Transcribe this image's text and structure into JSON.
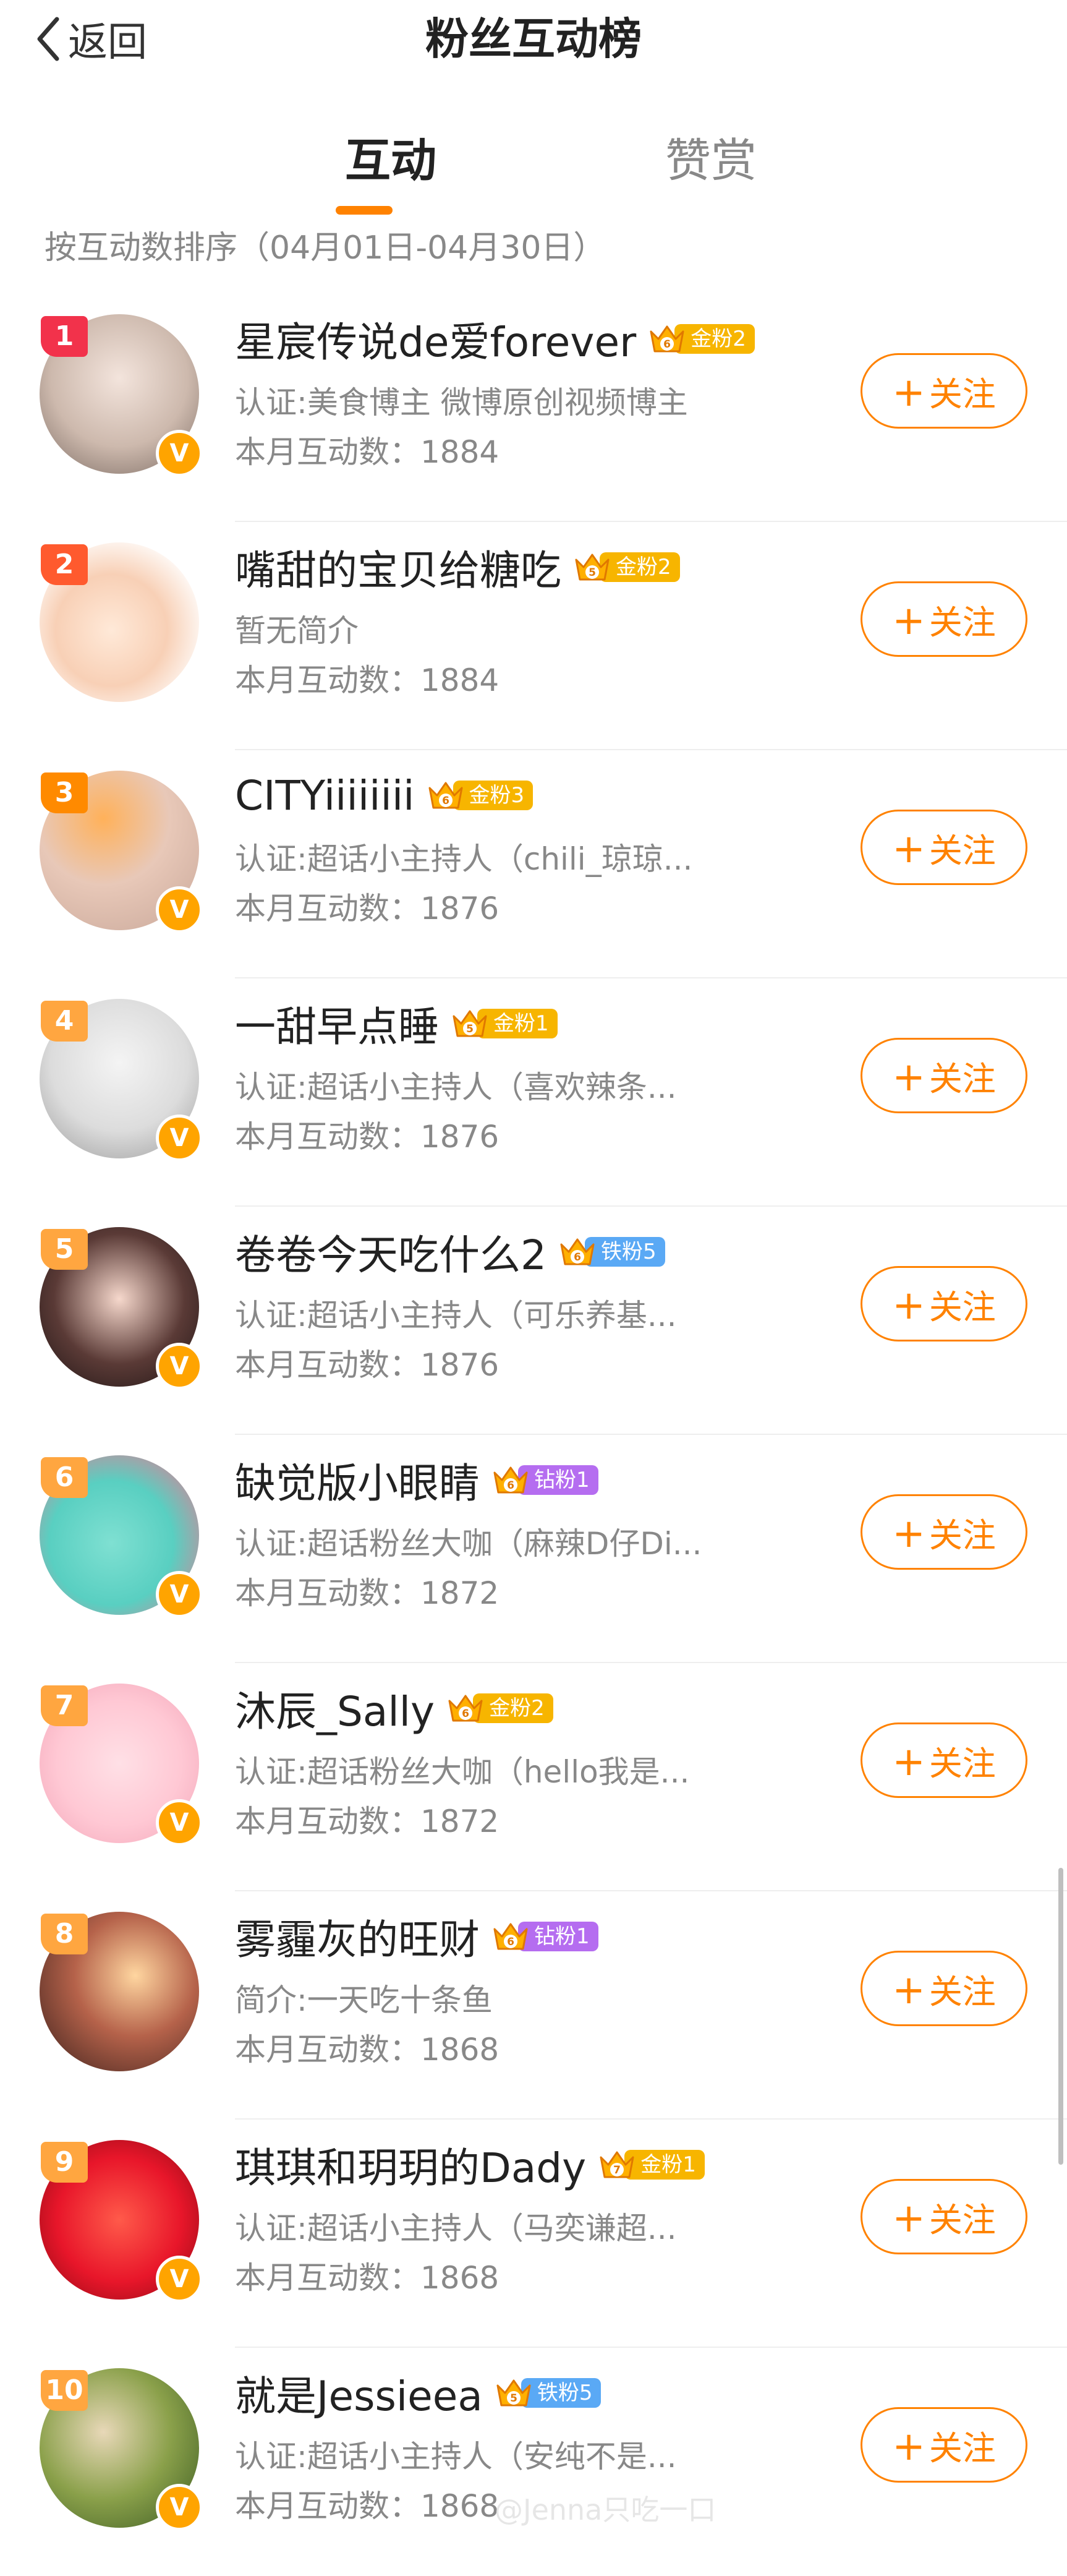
{
  "header": {
    "back_label": "返回",
    "title": "粉丝互动榜"
  },
  "tabs": {
    "active": "互动",
    "inactive": "赞赏"
  },
  "sort_label": "按互动数排序（04月01日-04月30日）",
  "follow_label": "关注",
  "verified_mark": "V",
  "watermark": "@Jenna只吃一口",
  "colors": {
    "accent": "#ff8200",
    "gold_badge": "#f7b500",
    "iron_badge": "#5aa9f5",
    "diamond_badge": "#b56df0"
  },
  "rows": [
    {
      "rank": "1",
      "name": "星宸传说de爱forever",
      "badge": "金粉2",
      "badge_level": "6",
      "desc": "认证:美食博主 微博原创视频博主",
      "count": "本月互动数：1884",
      "verified": true
    },
    {
      "rank": "2",
      "name": "嘴甜的宝贝给糖吃",
      "badge": "金粉2",
      "badge_level": "5",
      "desc": "暂无简介",
      "count": "本月互动数：1884",
      "verified": false
    },
    {
      "rank": "3",
      "name": "CITYiiiiiiii",
      "badge": "金粉3",
      "badge_level": "6",
      "desc": "认证:超话小主持人（chili_琼琼...",
      "count": "本月互动数：1876",
      "verified": true
    },
    {
      "rank": "4",
      "name": "一甜早点睡",
      "badge": "金粉1",
      "badge_level": "5",
      "desc": "认证:超话小主持人（喜欢辣条...",
      "count": "本月互动数：1876",
      "verified": true
    },
    {
      "rank": "5",
      "name": "卷卷今天吃什么2",
      "badge": "铁粉5",
      "badge_level": "6",
      "desc": "认证:超话小主持人（可乐养基...",
      "count": "本月互动数：1876",
      "verified": true
    },
    {
      "rank": "6",
      "name": "缺觉版小眼睛",
      "badge": "钻粉1",
      "badge_level": "6",
      "desc": "认证:超话粉丝大咖（麻辣D仔Di...",
      "count": "本月互动数：1872",
      "verified": true
    },
    {
      "rank": "7",
      "name": "沐辰_Sally",
      "badge": "金粉2",
      "badge_level": "6",
      "desc": "认证:超话粉丝大咖（hello我是...",
      "count": "本月互动数：1872",
      "verified": true
    },
    {
      "rank": "8",
      "name": "雾霾灰的旺财",
      "badge": "钻粉1",
      "badge_level": "6",
      "desc": "简介:一天吃十条鱼",
      "count": "本月互动数：1868",
      "verified": false
    },
    {
      "rank": "9",
      "name": "琪琪和玥玥的Dady",
      "badge": "金粉1",
      "badge_level": "7",
      "desc": "认证:超话小主持人（马奕谦超...",
      "count": "本月互动数：1868",
      "verified": true
    },
    {
      "rank": "10",
      "name": "就是Jessieea",
      "badge": "铁粉5",
      "badge_level": "5",
      "desc": "认证:超话小主持人（安纯不是...",
      "count": "本月互动数：1868",
      "verified": true
    }
  ]
}
